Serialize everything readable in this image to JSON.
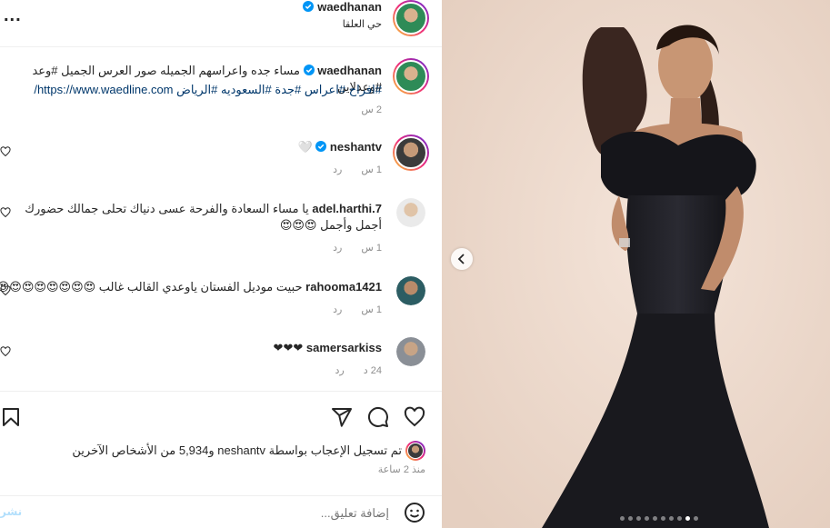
{
  "post_header": {
    "username": "waedhanan",
    "location": "حي العلقا",
    "more_label": "..."
  },
  "caption": {
    "username": "waedhanan",
    "line1": "مساء جده واعراسهم الجميله صور العرس الجميل #وعد #وعدلاين",
    "line2": "#افراح #اعراس #جدة #السعوديه #الرياض https://www.waedline.com/",
    "time": "2 س"
  },
  "comments": [
    {
      "username": "neshantv",
      "text": "🤍",
      "time": "1 س",
      "reply": "رد",
      "verified": true
    },
    {
      "username": "adel.harthi.7",
      "text": "يا مساء السعادة والفرحة عسى دنياك تحلى جمالك حضورك أجمل وأجمل 😍😍😍",
      "time": "1 س",
      "reply": "رد",
      "verified": false
    },
    {
      "username": "rahooma1421",
      "text": "حبيت موديل الفستان ياوعدي القالب غالب 😍😍😍😍😍😍😍😍😍",
      "time": "1 س",
      "reply": "رد",
      "verified": false
    },
    {
      "username": "samersarkiss",
      "text": "❤❤❤",
      "time": "24 د",
      "reply": "رد",
      "verified": false
    }
  ],
  "likes": {
    "text": "تم تسجيل الإعجاب بواسطة neshantv و5,934 من الأشخاص الآخرين",
    "time": "منذ 2 ساعة"
  },
  "comment_input": {
    "placeholder": "إضافة تعليق...",
    "post_label": "نشر"
  },
  "colors": {
    "accent": "#0095f6",
    "verified": "#0095f6",
    "link": "#00376b"
  },
  "carousel": {
    "total": 10,
    "active": 9
  }
}
